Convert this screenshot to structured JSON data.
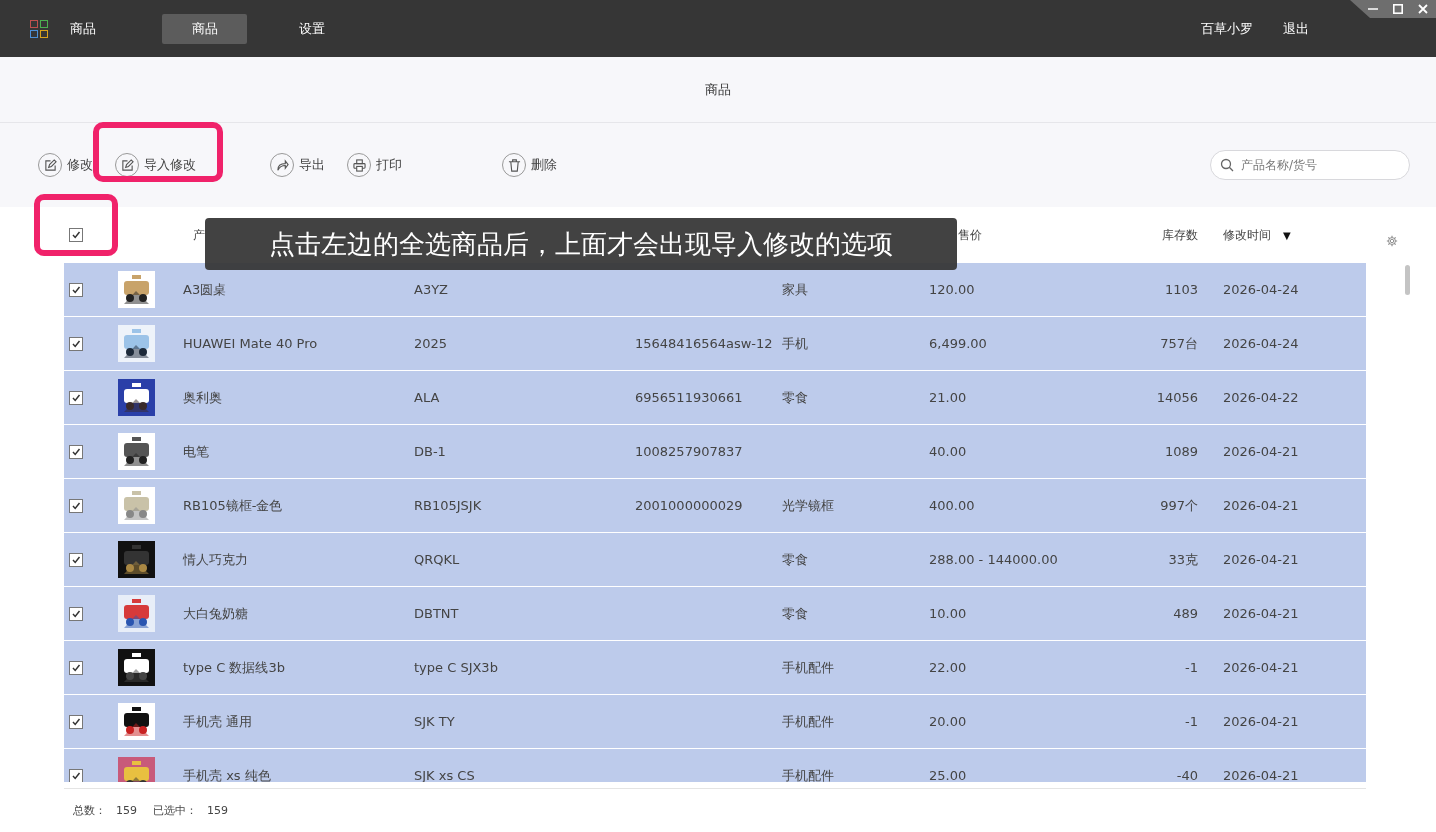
{
  "app_bar": {
    "brand": "商品",
    "nav": [
      {
        "label": "商品",
        "selected": true
      },
      {
        "label": "设置",
        "selected": false
      }
    ],
    "user": "百草小罗",
    "logout": "退出"
  },
  "page_title": "商品",
  "toolbar": {
    "actions": [
      {
        "label": "修改",
        "kind": "edit",
        "highlighted": false
      },
      {
        "label": "导入修改",
        "kind": "edit",
        "highlighted": true
      },
      {
        "label": "导出",
        "kind": "export",
        "highlighted": false
      },
      {
        "label": "打印",
        "kind": "print",
        "highlighted": false
      },
      {
        "label": "删除",
        "kind": "delete",
        "highlighted": false
      }
    ],
    "search": {
      "placeholder": "产品名称/货号"
    }
  },
  "table": {
    "select_all": {
      "checked": true,
      "highlighted": true
    },
    "header": {
      "name": "产",
      "price": "售价",
      "stock": "库存数",
      "modified": "修改时间",
      "sort_mark": "▼"
    },
    "rows": [
      {
        "selected": true,
        "name": "A3圆桌",
        "code": "A3YZ",
        "category": "家具",
        "price": "120.00",
        "stock": "1103",
        "modified": "2026-04-24"
      },
      {
        "selected": true,
        "name": "HUAWEI Mate 40 Pro",
        "code": "2025",
        "barcode": "15648416564asw-12",
        "category": "手机",
        "price": "6,499.00",
        "stock": "757台",
        "modified": "2026-04-24"
      },
      {
        "selected": true,
        "name": "奥利奥",
        "code": "ALA",
        "barcode": "6956511930661",
        "category": "零食",
        "price": "21.00",
        "stock": "14056",
        "modified": "2026-04-22"
      },
      {
        "selected": true,
        "name": "电笔",
        "code": "DB-1",
        "barcode": "1008257907837",
        "price": "40.00",
        "stock": "1089",
        "modified": "2026-04-21"
      },
      {
        "selected": true,
        "name": "RB105镜框-金色",
        "code": "RB105JSJK",
        "barcode": "2001000000029",
        "category": "光学镜框",
        "price": "400.00",
        "stock": "997个",
        "modified": "2026-04-21"
      },
      {
        "selected": true,
        "name": "情人巧克力",
        "code": "QRQKL",
        "category": "零食",
        "price": "288.00 - 144000.00",
        "stock": "33克",
        "modified": "2026-04-21"
      },
      {
        "selected": true,
        "name": "大白兔奶糖",
        "code": "DBTNT",
        "category": "零食",
        "price": "10.00",
        "stock": "489",
        "modified": "2026-04-21"
      },
      {
        "selected": true,
        "name": "type C 数据线3b",
        "code": "type C SJX3b",
        "category": "手机配件",
        "price": "22.00",
        "stock": "-1",
        "modified": "2026-04-21"
      },
      {
        "selected": true,
        "name": "手机壳 通用",
        "code": "SJK TY",
        "category": "手机配件",
        "price": "20.00",
        "stock": "-1",
        "modified": "2026-04-21"
      },
      {
        "selected": true,
        "name": "手机壳 xs 纯色",
        "code": "SJK xs CS",
        "category": "手机配件",
        "price": "25.00",
        "stock": "-40",
        "modified": "2026-04-21"
      }
    ]
  },
  "annotation": {
    "text": "点击左边的全选商品后，上面才会出现导入修改的选项"
  },
  "footer": {
    "total_label": "总数：",
    "total": "159",
    "selected_label": "已选中：",
    "selected": "159"
  }
}
